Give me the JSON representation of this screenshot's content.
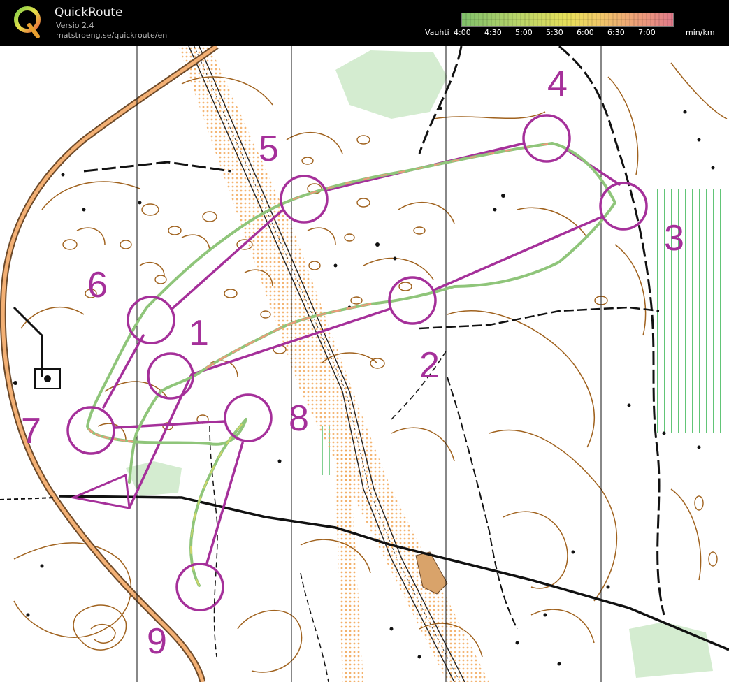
{
  "app": {
    "title": "QuickRoute",
    "version": "Versio 2.4",
    "url": "matstroeng.se/quickroute/en"
  },
  "pace_legend": {
    "label": "Vauhti",
    "ticks": [
      "4:00",
      "4:30",
      "5:00",
      "5:30",
      "6:00",
      "6:30",
      "7:00"
    ],
    "unit": "min/km",
    "gradient_colors": [
      "#7fbf6a",
      "#b5d36a",
      "#e8e05a",
      "#f0c868",
      "#ec9a7a",
      "#e07a8a"
    ]
  },
  "map": {
    "course_color": "#a5309a",
    "route_pace_colors": [
      "#8fc57a",
      "#d6dc6a",
      "#ec9a7a"
    ],
    "controls": [
      {
        "number": "1",
        "id": "control-1"
      },
      {
        "number": "2",
        "id": "control-2"
      },
      {
        "number": "3",
        "id": "control-3"
      },
      {
        "number": "4",
        "id": "control-4"
      },
      {
        "number": "5",
        "id": "control-5"
      },
      {
        "number": "6",
        "id": "control-6"
      },
      {
        "number": "7",
        "id": "control-7"
      },
      {
        "number": "8",
        "id": "control-8"
      },
      {
        "number": "9",
        "id": "control-9"
      }
    ]
  }
}
